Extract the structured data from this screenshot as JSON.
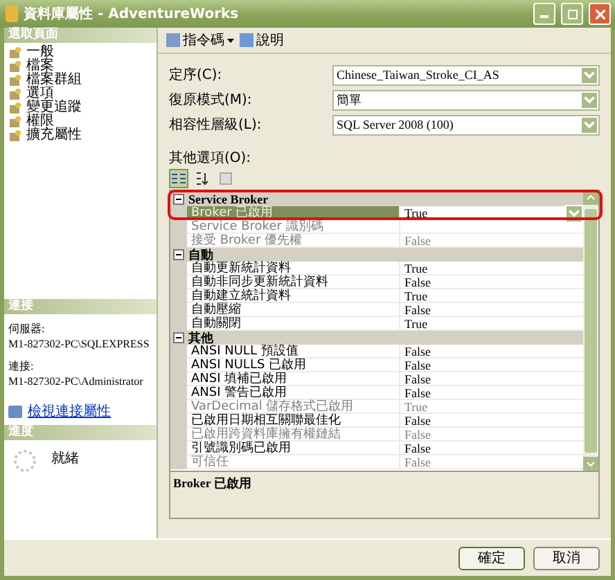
{
  "window": {
    "title": "資料庫屬性 - AdventureWorks"
  },
  "sidebar": {
    "heading": "選取頁面",
    "pages": [
      {
        "label": "一般"
      },
      {
        "label": "檔案"
      },
      {
        "label": "檔案群組"
      },
      {
        "label": "選項"
      },
      {
        "label": "變更追蹤"
      },
      {
        "label": "權限"
      },
      {
        "label": "擴充屬性"
      }
    ]
  },
  "connection": {
    "heading": "連接",
    "server_label": "伺服器:",
    "server": "M1-827302-PC\\SQLEXPRESS",
    "connection_label": "連接:",
    "connection": "M1-827302-PC\\Administrator",
    "link": "檢視連接屬性"
  },
  "progress": {
    "heading": "進度",
    "status": "就緒"
  },
  "toolbar": {
    "script": "指令碼",
    "help": "說明"
  },
  "fields": [
    {
      "label": "定序(C):",
      "value": "Chinese_Taiwan_Stroke_CI_AS"
    },
    {
      "label": "復原模式(M):",
      "value": "簡單"
    },
    {
      "label": "相容性層級(L):",
      "value": "SQL Server 2008 (100)"
    }
  ],
  "options": {
    "label": "其他選項(O):",
    "categories": [
      {
        "name": "Service Broker",
        "expanded": true,
        "highlighted": true,
        "rows": [
          {
            "name": "Broker 已啟用",
            "value": "True",
            "disabled": false,
            "selected": true
          },
          {
            "name": "Service Broker 識別碼",
            "disabled": true,
            "selected": false
          },
          {
            "name": "接受 Broker 優先權",
            "value": "False",
            "disabled": true,
            "selected": false
          }
        ]
      },
      {
        "name": "自動",
        "expanded": true,
        "highlighted": false,
        "rows": [
          {
            "name": "自動更新統計資料",
            "value": "True",
            "disabled": false,
            "selected": false
          },
          {
            "name": "自動非同步更新統計資料",
            "value": "False",
            "disabled": false,
            "selected": false
          },
          {
            "name": "自動建立統計資料",
            "value": "True",
            "disabled": false,
            "selected": false
          },
          {
            "name": "自動壓縮",
            "value": "False",
            "disabled": false,
            "selected": false
          },
          {
            "name": "自動關閉",
            "value": "True",
            "disabled": false,
            "selected": false
          }
        ]
      },
      {
        "name": "其他",
        "expanded": true,
        "highlighted": false,
        "rows": [
          {
            "name": "ANSI NULL 預設值",
            "value": "False",
            "disabled": false,
            "selected": false
          },
          {
            "name": "ANSI NULLS 已啟用",
            "value": "False",
            "disabled": false,
            "selected": false
          },
          {
            "name": "ANSI 填補已啟用",
            "value": "False",
            "disabled": false,
            "selected": false
          },
          {
            "name": "ANSI 警告已啟用",
            "value": "False",
            "disabled": false,
            "selected": false
          },
          {
            "name": "VarDecimal 儲存格式已啟用",
            "value": "True",
            "disabled": true,
            "selected": false
          },
          {
            "name": "已啟用日期相互關聯最佳化",
            "value": "False",
            "disabled": false,
            "selected": false
          },
          {
            "name": "已啟用跨資料庫擁有權鏈結",
            "value": "False",
            "disabled": true,
            "selected": false
          },
          {
            "name": "引號識別碼已啟用",
            "value": "False",
            "disabled": false,
            "selected": false
          },
          {
            "name": "可信任",
            "value": "False",
            "disabled": true,
            "selected": false
          }
        ]
      }
    ],
    "description": "Broker 已啟用"
  },
  "buttons": [
    "確定",
    "取消"
  ]
}
